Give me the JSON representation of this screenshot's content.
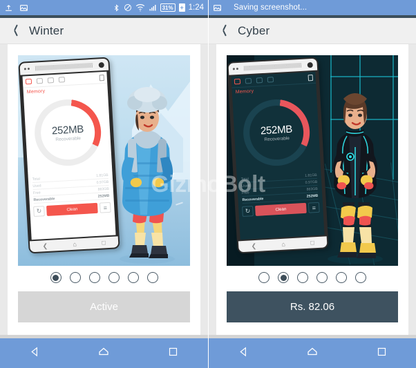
{
  "status_bar": {
    "left_icons": [
      "upload-icon",
      "image-icon"
    ],
    "right_icons": [
      "bluetooth-icon",
      "do-not-disturb-icon",
      "wifi-icon",
      "signal-icon"
    ],
    "battery_text": "31%",
    "battery_charging": true,
    "time": "1:24",
    "notification_text": "Saving screenshot...",
    "background_color": "#6f9bd8"
  },
  "panels": [
    {
      "appbar": {
        "back_label": "back",
        "title": "Winter"
      },
      "preview": {
        "theme": "winter",
        "phone": {
          "tabs": [
            "memory-tab",
            "storage-tab",
            "trash-tab",
            "contacts-tab"
          ],
          "trash_icon": "trash-icon",
          "section_label": "Memory",
          "ring_value": "252MB",
          "ring_caption": "Recoverable",
          "stats": [
            {
              "label": "Total",
              "value": "1.81GB"
            },
            {
              "label": "Used",
              "value": "0.97GB"
            },
            {
              "label": "Free",
              "value": "863GB"
            },
            {
              "label": "Recoverable",
              "value": "252MB"
            }
          ],
          "refresh_icon": "refresh-icon",
          "clean_label": "Clean",
          "settings_icon": "sliders-icon",
          "nav_icons": [
            "back-icon",
            "home-icon",
            "recents-icon"
          ]
        }
      },
      "dots": {
        "count": 6,
        "selected": 0
      },
      "action_button": {
        "label": "Active",
        "state": "inactive",
        "color": "#d6d6d6"
      }
    },
    {
      "appbar": {
        "back_label": "back",
        "title": "Cyber"
      },
      "preview": {
        "theme": "cyber",
        "phone": {
          "tabs": [
            "memory-tab",
            "storage-tab",
            "trash-tab",
            "contacts-tab"
          ],
          "trash_icon": "trash-icon",
          "section_label": "Memory",
          "ring_value": "252MB",
          "ring_caption": "Recoverable",
          "stats": [
            {
              "label": "Total",
              "value": "1.81GB"
            },
            {
              "label": "Used",
              "value": "0.97GB"
            },
            {
              "label": "Free",
              "value": "863GB"
            },
            {
              "label": "Recoverable",
              "value": "252MB"
            }
          ],
          "refresh_icon": "refresh-icon",
          "clean_label": "Clean",
          "settings_icon": "sliders-icon",
          "nav_icons": [
            "back-icon",
            "home-icon",
            "recents-icon"
          ]
        }
      },
      "dots": {
        "count": 6,
        "selected": 1
      },
      "action_button": {
        "label": "Rs. 82.06",
        "state": "price",
        "color": "#3e5260"
      }
    }
  ],
  "watermark": {
    "text_light": "Gizmo",
    "text_bold": "Bolt"
  },
  "nav_bar": {
    "background_color": "#6f9bd8",
    "items": [
      "back-icon",
      "home-icon",
      "recents-icon"
    ]
  }
}
